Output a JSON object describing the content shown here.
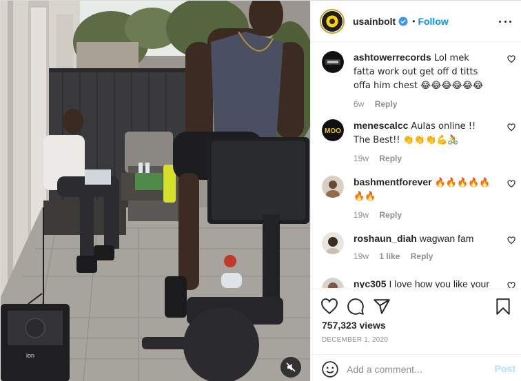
{
  "post": {
    "username": "usainbolt",
    "follow_label": "Follow",
    "dot": "•",
    "views": "757,323 views",
    "date": "December 1, 2020",
    "add_comment_placeholder": "Add a comment...",
    "post_label": "Post"
  },
  "video": {
    "speaker_brand": "ion"
  },
  "comments": [
    {
      "user": "ashtowerrecords",
      "text": "Lol mek fatta work out get off d titts offa him chest 😂😂😂😂😂😂",
      "age": "6w",
      "likes": "",
      "reply": "Reply"
    },
    {
      "user": "menescalcc",
      "text": "Aulas online !! The Best!! 👏👏👏💪🚴",
      "age": "19w",
      "likes": "",
      "reply": "Reply"
    },
    {
      "user": "bashmentforever",
      "text": "🔥🔥🔥🔥🔥🔥🔥",
      "age": "19w",
      "likes": "",
      "reply": "Reply"
    },
    {
      "user": "roshaun_diah",
      "text": "wagwan fam",
      "age": "19w",
      "likes": "1 like",
      "reply": "Reply"
    },
    {
      "user": "nyc305",
      "text": "I love how you like your",
      "age": "",
      "likes": "",
      "reply": ""
    }
  ],
  "avatar_labels": {
    "menescalcc": "MOO"
  },
  "colors": {
    "accent": "#0095f6",
    "post_disabled": "#b2dffc",
    "secondary_text": "#8e8e8e",
    "border": "#efefef"
  },
  "icons": [
    "verified-badge-icon",
    "more-options-icon",
    "heart-icon",
    "comment-icon",
    "share-icon",
    "bookmark-icon",
    "smile-icon",
    "mute-icon"
  ]
}
